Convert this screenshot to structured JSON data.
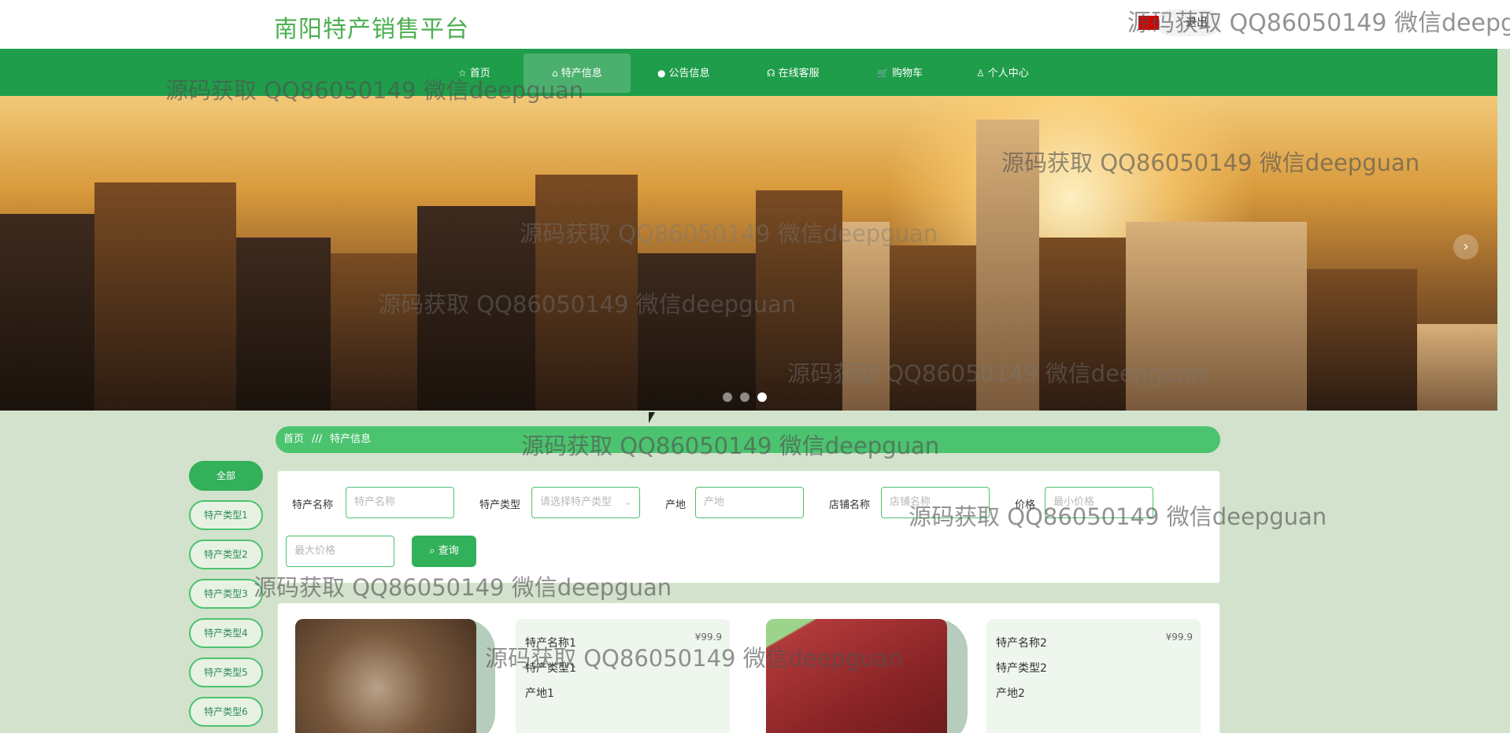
{
  "site": {
    "title": "南阳特产销售平台",
    "logout_label": "退出"
  },
  "nav": {
    "items": [
      {
        "label": "首页",
        "icon": "☆"
      },
      {
        "label": "特产信息",
        "icon": "⌂"
      },
      {
        "label": "公告信息",
        "icon": "●"
      },
      {
        "label": "在线客服",
        "icon": "☊"
      },
      {
        "label": "购物车",
        "icon": "🛒"
      },
      {
        "label": "个人中心",
        "icon": "♙"
      }
    ],
    "active_index": 1
  },
  "banner": {
    "slide_count": 3,
    "active_slide": 3,
    "next_arrow": "›"
  },
  "breadcrumb": {
    "home": "首页",
    "separator": "///",
    "current": "特产信息"
  },
  "sidebar": {
    "items": [
      "全部",
      "特产类型1",
      "特产类型2",
      "特产类型3",
      "特产类型4",
      "特产类型5",
      "特产类型6"
    ],
    "active_index": 0
  },
  "search": {
    "fields": [
      {
        "label": "特产名称",
        "placeholder": "特产名称"
      },
      {
        "label": "特产类型",
        "placeholder": "请选择特产类型"
      },
      {
        "label": "产地",
        "placeholder": "产地"
      },
      {
        "label": "店铺名称",
        "placeholder": "店铺名称"
      },
      {
        "label": "价格",
        "placeholder": "最小价格"
      }
    ],
    "max_price_placeholder": "最大价格",
    "button_label": "查询"
  },
  "products": [
    {
      "name": "特产名称1",
      "type": "特产类型1",
      "origin": "产地1",
      "price": "¥99.9"
    },
    {
      "name": "特产名称2",
      "type": "特产类型2",
      "origin": "产地2",
      "price": "¥99.9"
    }
  ],
  "watermark": "源码获取 QQ86050149 微信deepguan",
  "colors": {
    "primary": "#1f9d4a",
    "accent": "#4cc36f",
    "background": "#d3e2cc"
  }
}
